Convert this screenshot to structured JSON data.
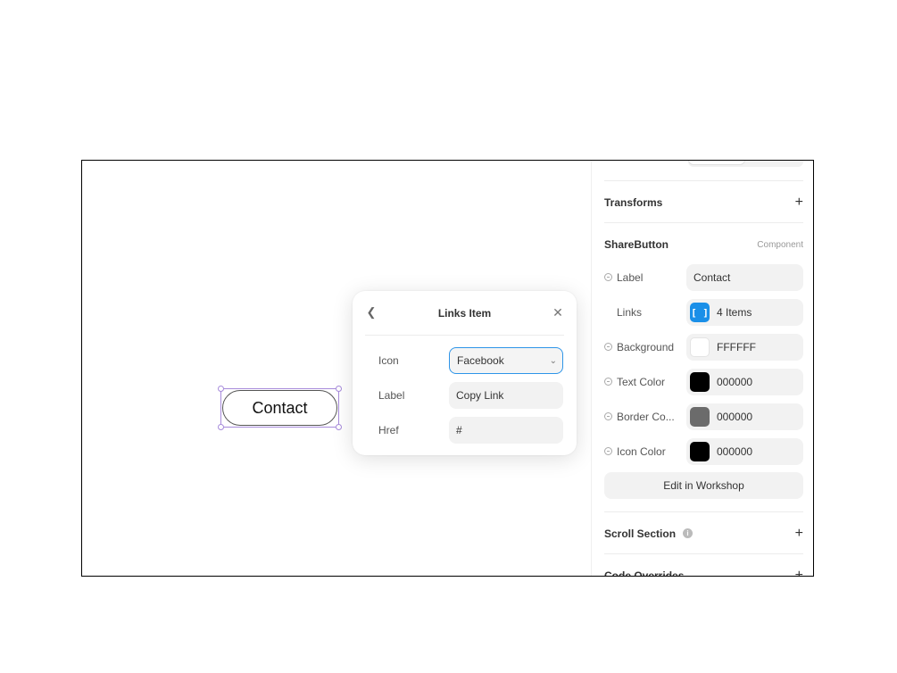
{
  "canvas": {
    "contact_button_label": "Contact"
  },
  "popover": {
    "title": "Links Item",
    "back_icon": "chevron-left-icon",
    "close_icon": "close-icon",
    "fields": {
      "icon": {
        "label": "Icon",
        "value": "Facebook"
      },
      "label": {
        "label": "Label",
        "value": "Copy Link"
      },
      "href": {
        "label": "Href",
        "value": "#"
      }
    }
  },
  "panel": {
    "transforms": {
      "title": "Transforms"
    },
    "component": {
      "title": "ShareButton",
      "tag": "Component",
      "props": {
        "label": {
          "label": "Label",
          "value": "Contact"
        },
        "links": {
          "label": "Links",
          "value": "4 Items"
        },
        "background": {
          "label": "Background",
          "value": "FFFFFF",
          "color": "#FFFFFF"
        },
        "text_color": {
          "label": "Text Color",
          "value": "000000",
          "color": "#000000"
        },
        "border_color": {
          "label": "Border Co...",
          "value": "000000",
          "color": "#6b6b6b"
        },
        "icon_color": {
          "label": "Icon Color",
          "value": "000000",
          "color": "#000000"
        }
      },
      "workshop_button": "Edit in Workshop"
    },
    "scroll_section": {
      "title": "Scroll Section"
    },
    "code_overrides": {
      "title": "Code Overrides"
    }
  },
  "colors": {
    "selection": "#a78bdb",
    "accent": "#1a8fe8"
  }
}
